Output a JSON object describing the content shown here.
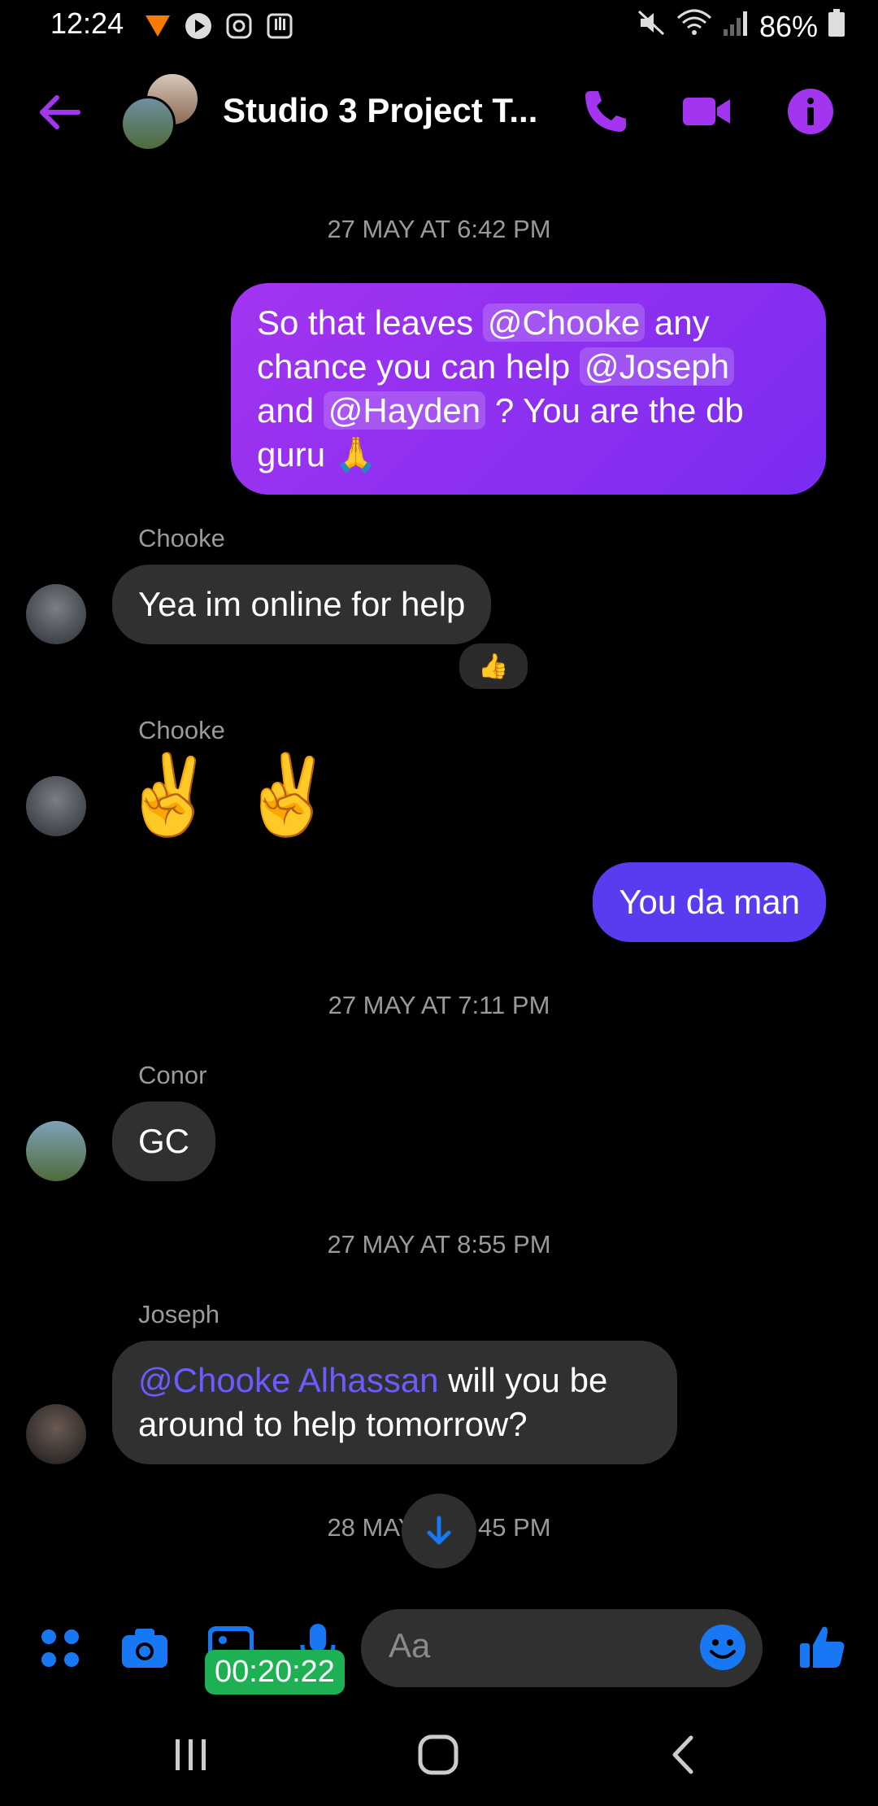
{
  "status": {
    "time": "12:24",
    "battery": "86%"
  },
  "header": {
    "title": "Studio 3 Project T..."
  },
  "messages": {
    "ts1": "27 MAY AT 6:42 PM",
    "m1": {
      "p1": "So that leaves ",
      "mention1": "@Chooke",
      "p2": " any chance you can help ",
      "mention2": "@Joseph",
      "p3": " and ",
      "mention3": "@Hayden",
      "p4": " ? You are the db guru 🙏"
    },
    "chooke_name1": "Chooke",
    "m2": "Yea im online for help",
    "m2_reaction": "👍",
    "chooke_name2": "Chooke",
    "m3": "✌️ ✌️",
    "m4": "You da man",
    "ts2": "27 MAY AT 7:11 PM",
    "conor_name": "Conor",
    "m5": "GC",
    "ts3": "27 MAY AT 8:55 PM",
    "joseph_name": "Joseph",
    "m6": {
      "mention": "@Chooke Alhassan",
      "text": " will you be around to help tomorrow?"
    },
    "ts4": "28 MAY AT 2:45 PM"
  },
  "composer": {
    "placeholder": "Aa"
  },
  "timer": "00:20:22",
  "colors": {
    "accent": "#a334f0",
    "blue": "#1877f2",
    "bubble_in": "#303030"
  }
}
